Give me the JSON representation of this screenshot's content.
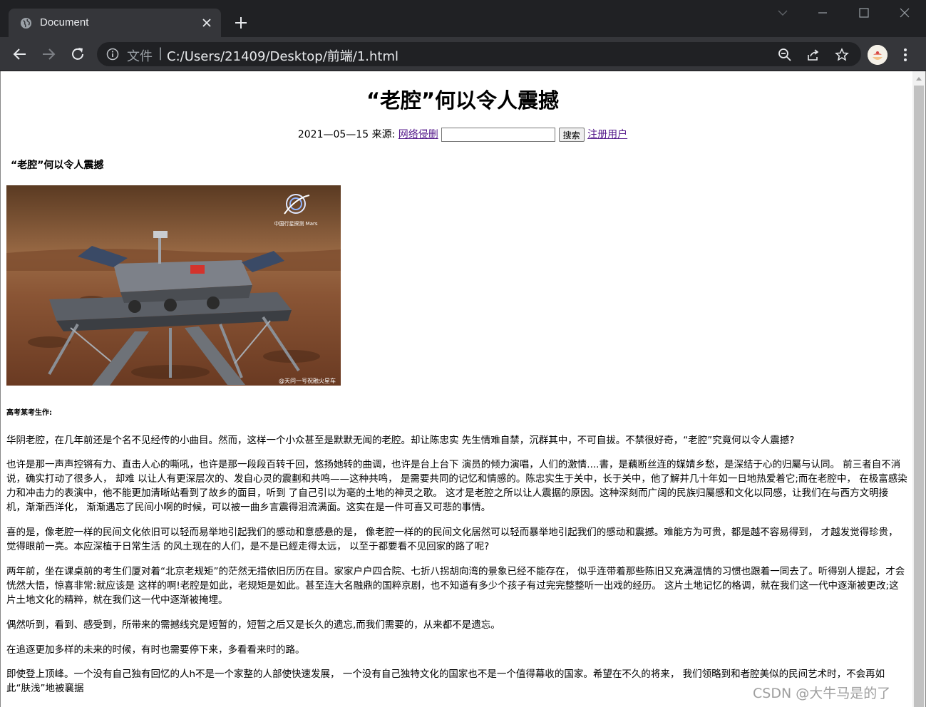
{
  "browser": {
    "tab_title": "Document",
    "address_scheme": "文件",
    "address_url": "C:/Users/21409/Desktop/前端/1.html"
  },
  "article": {
    "title": "“老腔”何以令人震撼",
    "date_source": "2021—05—15 来源:",
    "source_link": "网络侵删",
    "search_button": "搜索",
    "register_link": "注册用户",
    "subtitle": "“老腔”何以令人震撼",
    "author": "高考某考生作:",
    "paragraphs": [
      "华阴老腔，在几年前还是个名不见经传的小曲目。然而，这样一个小众甚至是默默无闻的老腔。却让陈忠实 先生情难自禁，沉群其中，不可自拔。不禁很好奇，“老腔”究竟何以令人震撼?",
      "也许是那一声声控锵有力、直击人心的嘶吼，也许是那一段段百转千回，悠扬她转的曲调，也许是台上台下 演员的倾力演唱，人们的激情....書，是藕断丝连的媒婧乡愁，是深结于心的归屬与认同。 前三者自不消说，确实打动了很多人， 却难 以让人有更深层次的、发自心灵的震劃和共鸣——这种共鸣， 是需要共同的记忆和情感的。陈忠实生于关中，长于关中，他了解并几十年如一日地热爱着它;而在老腔中， 在极富感染力和冲击力的表演中，他不能更加清晰站看到了故乡的面目，听到 了自己引以为毫的土地的神灵之歌。 这才是老腔之所以让人震据的原因。这种深刻而广阔的民族归屬感和文化以同感，让我们在与西方文明接机，渐渐西洋化， 渐渐遇忘了民间小啊的时候，可以被一曲乡言震得泪流满面。这实在是一件可喜又可悲的事情。",
      "喜的是，像老腔一样的民间文化依旧可以轻而易举地引起我们的感动和意感悬的是， 像老腔一样的的民间文化居然可以轻而暴举地引起我们的感动和震撼。难能方为可贵，都是越不容易得到， 才越发觉得珍贵，觉得眼前一亮。本应深植于日常生活 的风土现在的人们，是不是已經走得太远， 以至于都要看不见回家的路了呢?",
      "两年前，坐在课桌前的考生们厦对着“北京老规矩”的茫然无措依旧历历在目。家家户户四合院、七折八拐胡向湾的景象已经不能存在， 似乎连带着那些陈旧又充满温情的习惯也跟着一同去了。听得别人提起，才会恍然大悟，惊喜非常:就应该是 这样的啊!老腔是如此，老规矩是如此。甚至连大名融鼎的国粹京剧，也不知道有多少个孩子有过完完整整听一出戏的经历。 这片土地记忆的格调，就在我们这一代中逐渐被更改;这片土地文化的精粹，就在我们这一代中逐渐被掩埋。",
      "偶然听到，看到、感受到，所带来的需撼线究是短暂的，短暂之后又是长久的遗忘,而我们需要的，从来都不是遗忘。",
      "在追逐更加多样的未来的时候，有时也需要停下来，多看看来时的路。",
      "即使登上顶峰。一个没有自己独有回忆的人h不是一个家整的人部使快速发展， 一个没有自己独特文化的国家也不是一个值得幕收的国家。希望在不久的将来， 我们领略到和者腔美似的民间艺术时，不会再如此“肤浅”地被襄据"
    ],
    "image_caption_logo": "中国行星探测 Mars",
    "image_caption_credit": "@天问一号祝融火星车"
  },
  "watermark": "CSDN @大牛马是的了",
  "colors": {
    "chrome_dark": "#202124",
    "chrome_tab": "#35363a",
    "link_visited": "#551a8b"
  }
}
